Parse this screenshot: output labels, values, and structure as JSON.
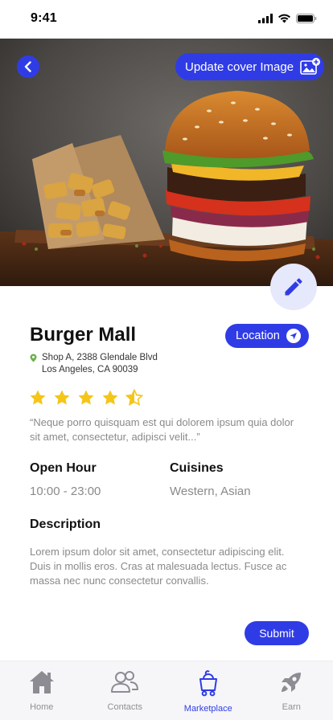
{
  "status_bar": {
    "time": "9:41"
  },
  "cover": {
    "update_label": "Update cover Image"
  },
  "restaurant": {
    "name": "Burger Mall",
    "location_label": "Location",
    "address_line1": "Shop A, 2388 Glendale Blvd",
    "address_line2": "Los Angeles, CA 90039",
    "rating": 4.5,
    "rating_max": 5,
    "quote": "“Neque porro quisquam est qui dolorem ipsum quia dolor sit amet, consectetur, adipisci velit...”"
  },
  "info": {
    "open_hour_label": "Open Hour",
    "open_hour_value": "10:00 - 23:00",
    "cuisines_label": "Cuisines",
    "cuisines_value": "Western, Asian"
  },
  "description": {
    "label": "Description",
    "text": "Lorem ipsum dolor sit amet, consectetur adipiscing elit. Duis in mollis eros. Cras at malesuada lectus. Fusce ac massa nec nunc consectetur convallis."
  },
  "actions": {
    "submit_label": "Submit"
  },
  "tabs": [
    {
      "label": "Home",
      "icon": "home-icon",
      "active": false
    },
    {
      "label": "Contacts",
      "icon": "contacts-icon",
      "active": false
    },
    {
      "label": "Marketplace",
      "icon": "marketplace-icon",
      "active": true
    },
    {
      "label": "Earn",
      "icon": "rocket-icon",
      "active": false
    }
  ],
  "colors": {
    "accent": "#2f3ce6",
    "star": "#f5c518",
    "fab_bg": "#e6e8fb"
  }
}
